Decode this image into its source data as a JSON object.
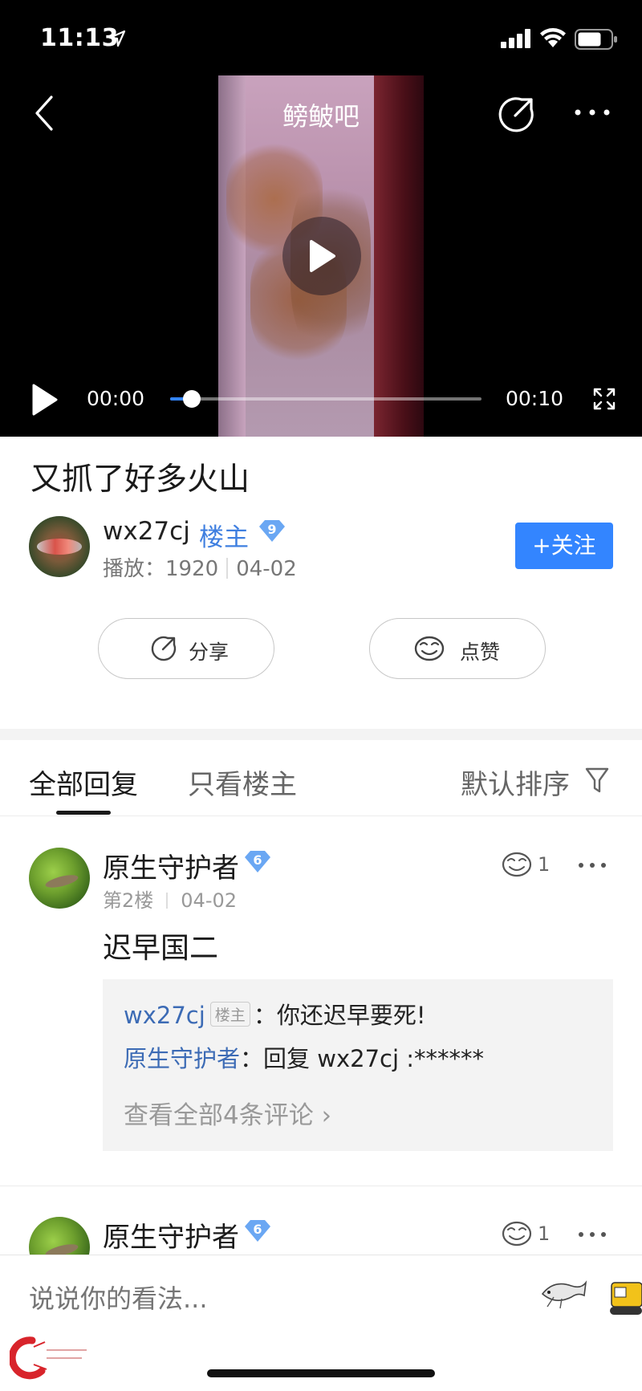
{
  "status_bar": {
    "time": "11:13"
  },
  "nav": {
    "title": "鳑鲏吧"
  },
  "player": {
    "current_time": "00:00",
    "duration": "00:10",
    "progress": 0.07
  },
  "post": {
    "title": "又抓了好多火山",
    "author": {
      "name": "wx27cj",
      "role": "楼主",
      "level": "9",
      "play_label": "播放：",
      "play_count": "1920",
      "date": "04-02"
    },
    "follow_label": "+关注",
    "share_label": "分享",
    "like_label": "点赞"
  },
  "tabs": {
    "all": "全部回复",
    "host_only": "只看楼主",
    "sort": "默认排序"
  },
  "replies": [
    {
      "name": "原生守护者",
      "level": "6",
      "floor": "第2楼",
      "date": "04-02",
      "likes": "1",
      "text": "迟早国二",
      "sub_comments": [
        {
          "user": "wx27cj",
          "tag": "楼主",
          "sep": "：",
          "text": "你还迟早要死!"
        },
        {
          "user": "原生守护者",
          "sep": "：",
          "text": "回复 wx27cj :******"
        }
      ],
      "view_all": "查看全部4条评论 ›"
    },
    {
      "name": "原生守护者",
      "level": "6",
      "likes": "1"
    }
  ],
  "bottom": {
    "placeholder": "说说你的看法..."
  },
  "colors": {
    "accent": "#3385ff",
    "link": "#3c6bb5",
    "role": "#3f7fe0"
  }
}
